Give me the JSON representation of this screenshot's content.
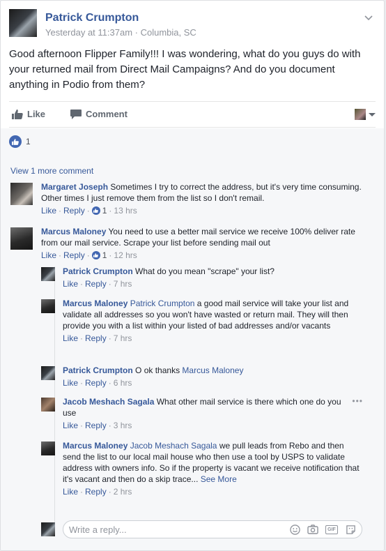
{
  "post": {
    "author": "Patrick Crumpton",
    "meta": "Yesterday at 11:37am · Columbia, SC",
    "text": "Good afternoon Flipper Family!!! I was wondering, what do you guys do with your returned mail from Direct Mail Campaigns? And do you document anything in Podio from them?",
    "like_label": "Like",
    "comment_label": "Comment",
    "reaction_count": "1"
  },
  "comments": {
    "view_more": "View 1 more comment",
    "like": "Like",
    "reply": "Reply",
    "sep": "·",
    "items": [
      {
        "name": "Margaret Joseph",
        "text": "Sometimes I try to correct the address, but it's very time consuming. Other times I just remove them from the list so I don't remail.",
        "likes": "1",
        "time": "13 hrs"
      },
      {
        "name": "Marcus Maloney",
        "text": "You need to use a better mail service we receive 100% deliver rate from our mail service. Scrape your list before sending mail out",
        "likes": "1",
        "time": "12 hrs"
      }
    ],
    "replies": [
      {
        "name": "Patrick Crumpton",
        "tag": "",
        "text": "What do you mean \"scrape\" your list?",
        "time": "7 hrs"
      },
      {
        "name": "Marcus Maloney",
        "tag": "Patrick Crumpton",
        "text": "a good mail service will take your list and validate all addresses so you won't have wasted or return mail. They will then provide you with a list within your listed of bad addresses and/or vacants",
        "time": "7 hrs"
      },
      {
        "name": "Patrick Crumpton",
        "tag": "",
        "text": "O ok thanks",
        "tag_after": "Marcus Maloney",
        "time": "6 hrs"
      },
      {
        "name": "Jacob Meshach Sagala",
        "tag": "",
        "text": "What other mail service is there which one do you use",
        "time": "3 hrs"
      },
      {
        "name": "Marcus Maloney",
        "tag": "Jacob Meshach Sagala",
        "text": "we pull leads from Rebo and then send the list to our local mail house who then use a tool by USPS to validate address with owners info. So if the property is vacant we receive notification that it's vacant and then do a skip trace...",
        "see_more": "See More",
        "time": "2 hrs"
      }
    ],
    "reply_placeholder": "Write a reply..."
  },
  "colors": {
    "link": "#365899",
    "accent": "#4267b2"
  }
}
